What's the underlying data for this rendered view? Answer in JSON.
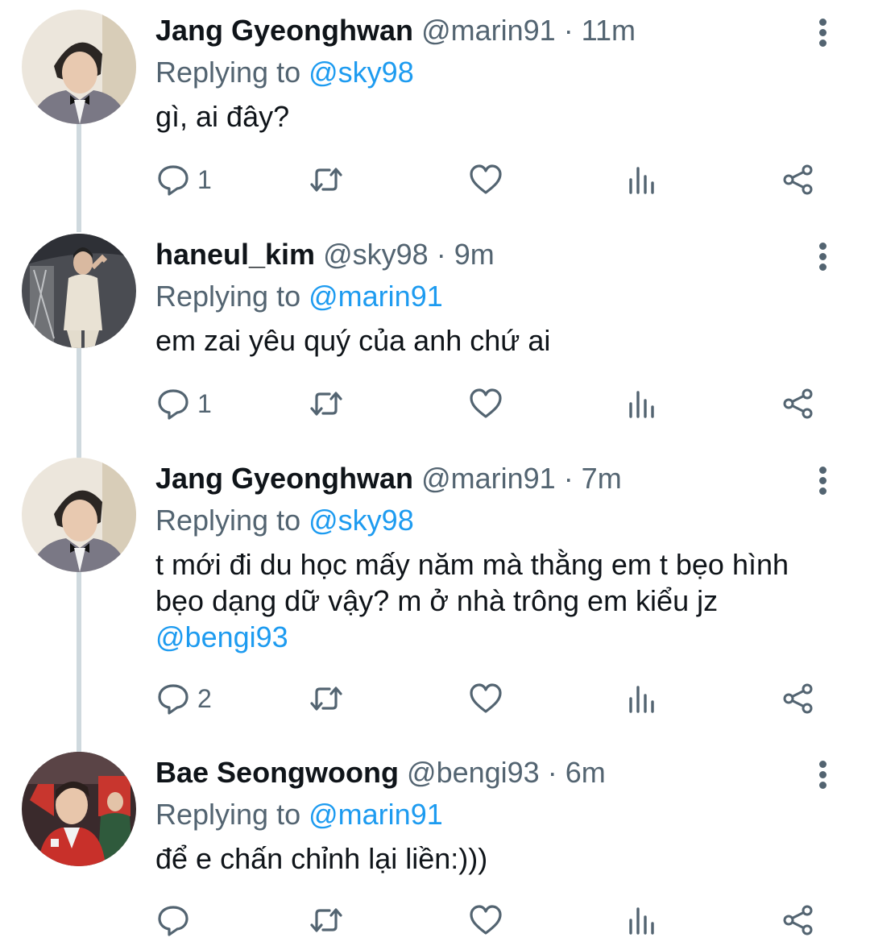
{
  "tweets": [
    {
      "name": "Jang Gyeonghwan",
      "handle": "@marin91",
      "time": "· 11m",
      "replying_label": "Replying to",
      "replying_to": "@sky98",
      "text": "gì, ai đây?",
      "mention": "",
      "reply_count": "1"
    },
    {
      "name": "haneul_kim",
      "handle": "@sky98",
      "time": "· 9m",
      "replying_label": "Replying to",
      "replying_to": "@marin91",
      "text": "em zai yêu quý của anh chứ ai",
      "mention": "",
      "reply_count": "1"
    },
    {
      "name": "Jang Gyeonghwan",
      "handle": "@marin91",
      "time": "· 7m",
      "replying_label": "Replying to",
      "replying_to": "@sky98",
      "text": "t mới đi du học mấy năm mà thằng em t bẹo hình\nbẹo dạng dữ vậy? m ở nhà trông em kiểu jz",
      "mention": "@bengi93",
      "reply_count": "2"
    },
    {
      "name": "Bae Seongwoong",
      "handle": "@bengi93",
      "time": "· 6m",
      "replying_label": "Replying to",
      "replying_to": "@marin91",
      "text": "để e chấn chỉnh lại liền:)))",
      "mention": "",
      "reply_count": ""
    }
  ],
  "icons": {
    "reply": "reply-icon",
    "retweet": "retweet-icon",
    "like": "heart-icon",
    "analytics": "analytics-icon",
    "share": "share-icon",
    "more": "more-icon"
  },
  "colors": {
    "text": "#0f1419",
    "secondary": "#536471",
    "accent": "#1d9bf0",
    "thread_line": "#cfd9de"
  }
}
